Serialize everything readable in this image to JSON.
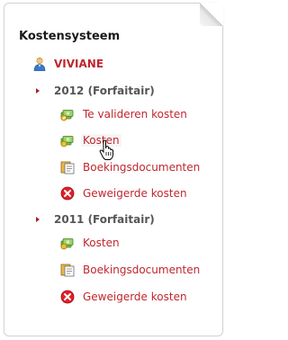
{
  "panel": {
    "title": "Kostensysteem",
    "user_name": "VIVIANE"
  },
  "years": [
    {
      "label": "2012 (Forfaitair)",
      "items": [
        {
          "label": "Te valideren kosten",
          "icon": "money-validate-icon"
        },
        {
          "label": "Kosten",
          "icon": "money-icon"
        },
        {
          "label": "Boekingsdocumenten",
          "icon": "documents-icon"
        },
        {
          "label": "Geweigerde kosten",
          "icon": "rejected-icon"
        }
      ]
    },
    {
      "label": "2011 (Forfaitair)",
      "items": [
        {
          "label": "Kosten",
          "icon": "money-icon"
        },
        {
          "label": "Boekingsdocumenten",
          "icon": "documents-icon"
        },
        {
          "label": "Geweigerde kosten",
          "icon": "rejected-icon"
        }
      ]
    }
  ],
  "colors": {
    "link": "#c0262d",
    "heading": "#1a1a1a",
    "year": "#555555",
    "arrow": "#b01e25"
  }
}
